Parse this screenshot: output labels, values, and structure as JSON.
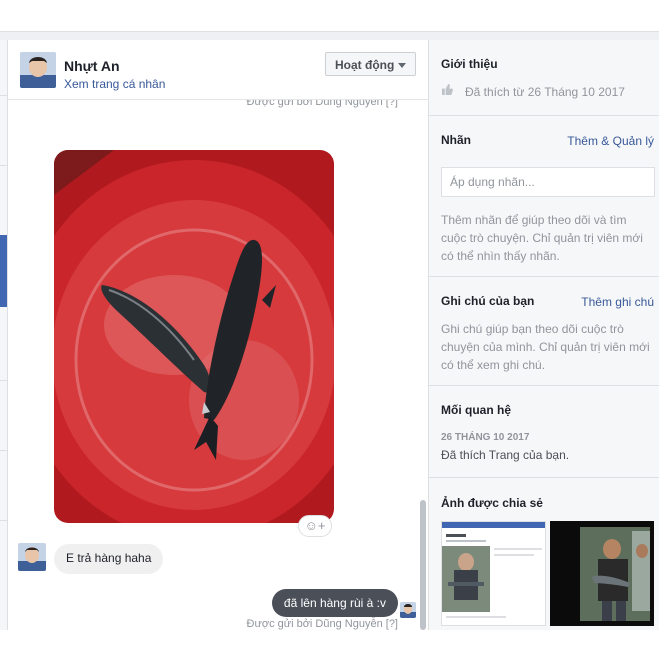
{
  "header": {
    "name": "Nhựt An",
    "profile_link": "Xem trang cá nhân",
    "status_button": "Hoạt động"
  },
  "thread": {
    "sent_by_top": "Được gửi bởi Dũng Nguyễn [?]",
    "photo_icon": "fish-photo",
    "react_icon": "add-reaction-icon",
    "incoming_message": "E trả hàng haha",
    "outgoing_message": "đã lên hàng rùi à :v",
    "sent_by_bottom": "Được gửi bởi Dũng Nguyễn [?]"
  },
  "sidebar": {
    "intro": {
      "title": "Giới thiệu",
      "liked_since": "Đã thích từ 26 Tháng 10 2017",
      "icon": "thumbs-up-icon"
    },
    "labels": {
      "title": "Nhãn",
      "action": "Thêm & Quản lý",
      "placeholder": "Áp dụng nhãn...",
      "help": "Thêm nhãn để giúp theo dõi và tìm cuộc trò chuyện. Chỉ quản trị viên mới có thể nhìn thấy nhãn."
    },
    "notes": {
      "title": "Ghi chú của bạn",
      "action": "Thêm ghi chú",
      "help": "Ghi chú giúp bạn theo dõi cuộc trò chuyện của mình. Chỉ quản trị viên mới có thể xem ghi chú."
    },
    "relationship": {
      "title": "Mối quan hệ",
      "date": "26 THÁNG 10 2017",
      "text": "Đã thích Trang của bạn."
    },
    "shared_photos": {
      "title": "Ảnh được chia sẻ"
    }
  },
  "colors": {
    "accent": "#4267b2",
    "link": "#385898",
    "outgoing_bubble": "#4a4f58",
    "incoming_bubble": "#f1f0f0",
    "sidebar_bg": "#f6f7f9"
  }
}
